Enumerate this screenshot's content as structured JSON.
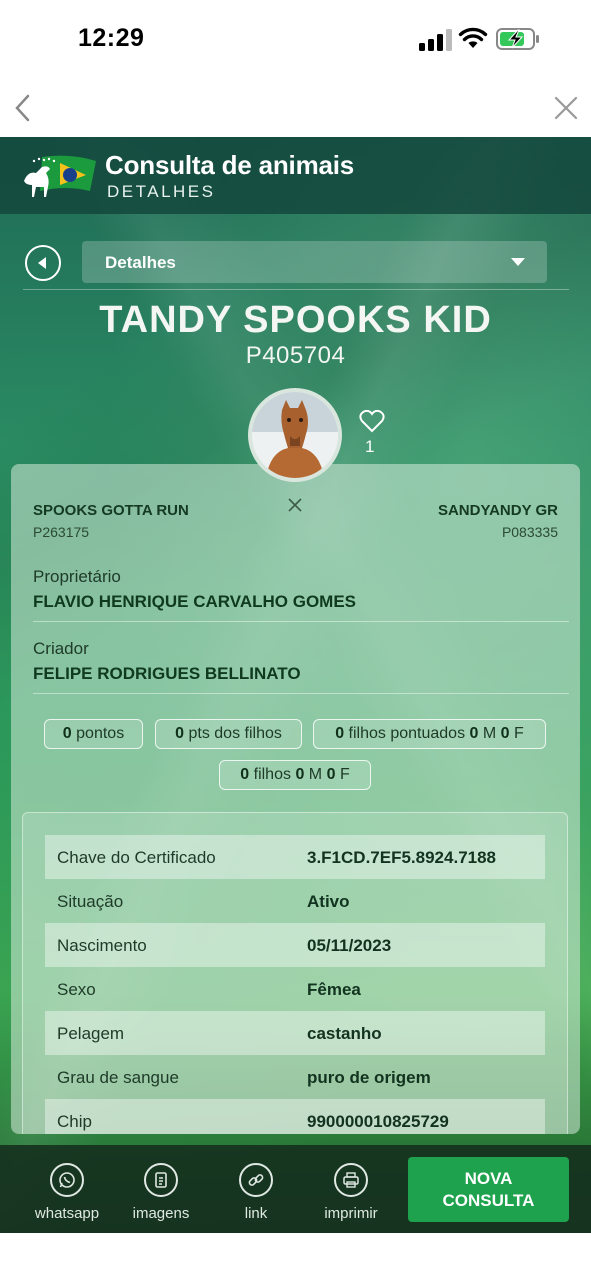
{
  "status_bar": {
    "time": "12:29"
  },
  "app": {
    "title": "Consulta de animais",
    "subtitle": "DETALHES",
    "section_select": "Detalhes"
  },
  "horse": {
    "name": "TANDY SPOOKS KID",
    "registration": "P405704",
    "likes": "1"
  },
  "parents": {
    "sire_name": "SPOOKS GOTTA RUN",
    "sire_reg": "P263175",
    "dam_name": "SANDYANDY GR",
    "dam_reg": "P083335"
  },
  "owner": {
    "label": "Proprietário",
    "value": "FLAVIO HENRIQUE CARVALHO GOMES"
  },
  "breeder": {
    "label": "Criador",
    "value": "FELIPE RODRIGUES BELLINATO"
  },
  "stats": {
    "pontos_n": "0",
    "pontos_l": "pontos",
    "pts_filhos_n": "0",
    "pts_filhos_l": "pts dos filhos",
    "filhos_pont_n": "0",
    "filhos_pont_l": "filhos pontuados",
    "filhos_pont_m": "0",
    "m1": "M",
    "filhos_pont_f": "0",
    "f1": "F",
    "filhos_n": "0",
    "filhos_l": "filhos",
    "filhos_m": "0",
    "m2": "M",
    "filhos_f": "0",
    "f2": "F"
  },
  "details": [
    {
      "key": "Chave do Certificado",
      "value": "3.F1CD.7EF5.8924.7188"
    },
    {
      "key": "Situação",
      "value": "Ativo"
    },
    {
      "key": "Nascimento",
      "value": "05/11/2023"
    },
    {
      "key": "Sexo",
      "value": "Fêmea"
    },
    {
      "key": "Pelagem",
      "value": "castanho"
    },
    {
      "key": "Grau de sangue",
      "value": "puro de origem"
    },
    {
      "key": "Chip",
      "value": "990000010825729"
    }
  ],
  "toolbar": {
    "whatsapp": "whatsapp",
    "imagens": "imagens",
    "link": "link",
    "imprimir": "imprimir",
    "nova_line1": "NOVA",
    "nova_line2": "CONSULTA"
  },
  "colors": {
    "accent": "#1ea24d",
    "header": "#12463c"
  }
}
